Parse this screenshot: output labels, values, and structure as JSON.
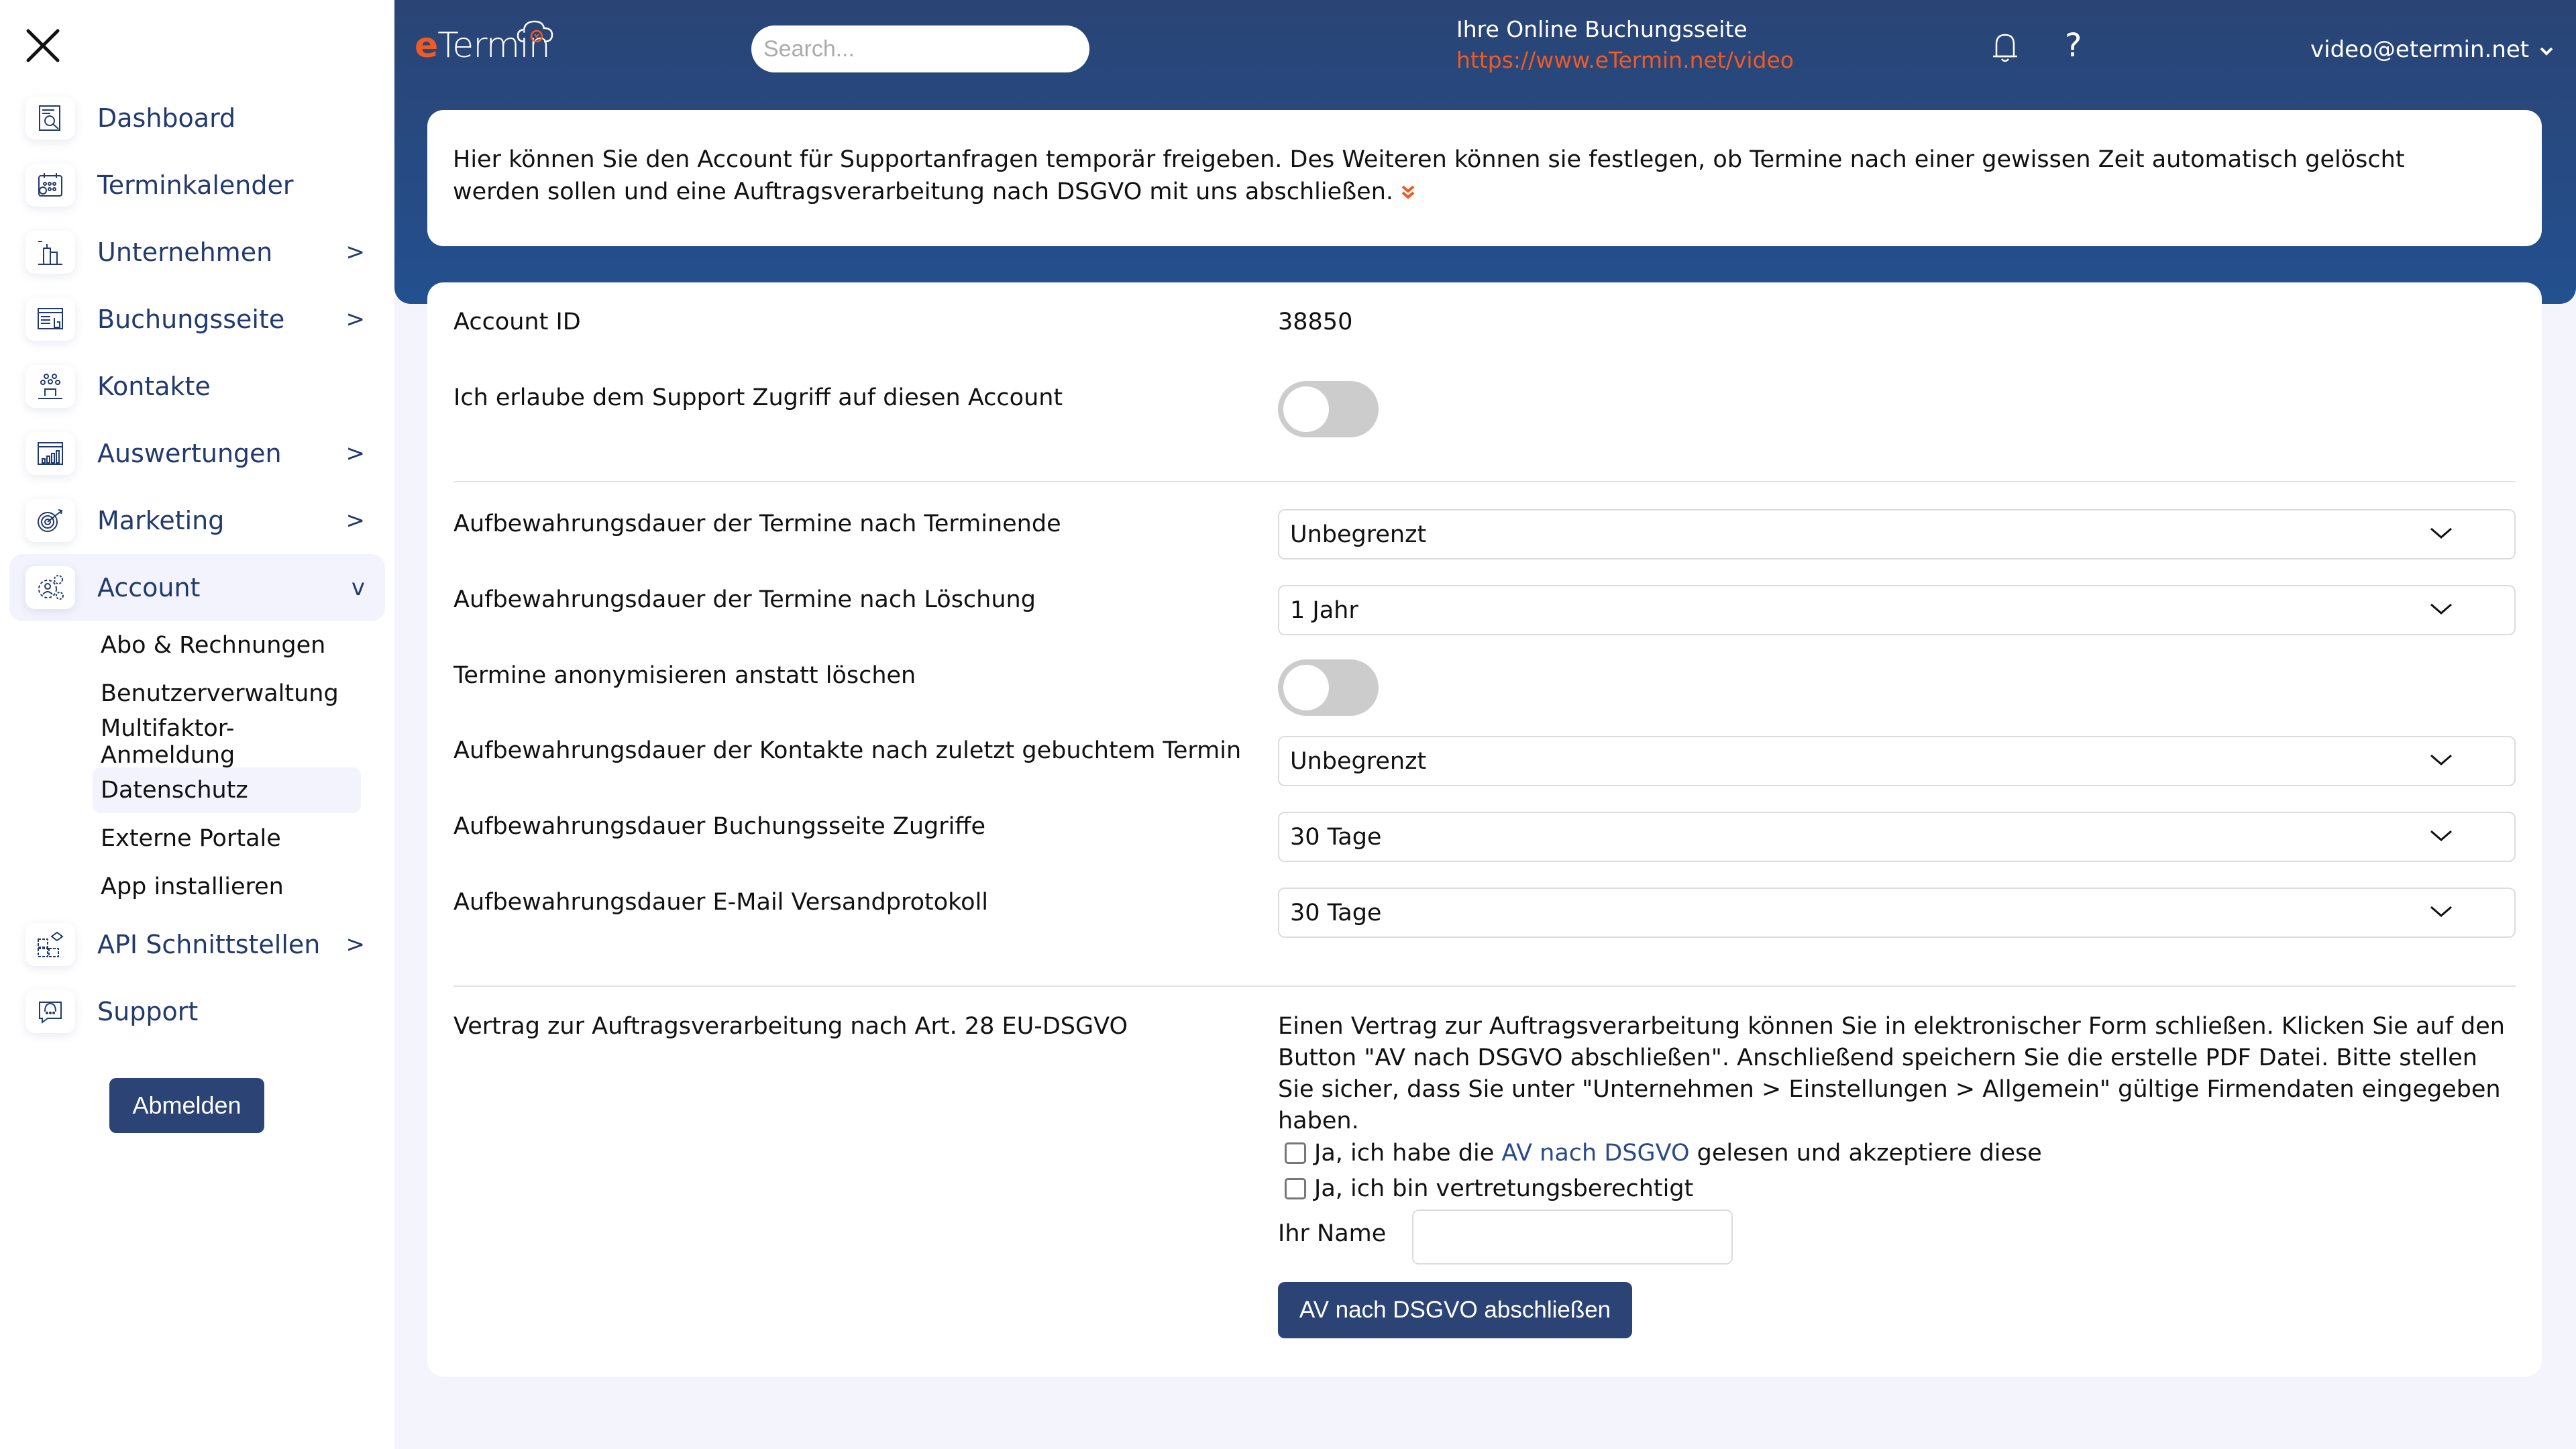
{
  "sidebar": {
    "close_icon": "close-icon",
    "items": [
      {
        "label": "Dashboard",
        "icon": "dashboard-icon",
        "arrow": ""
      },
      {
        "label": "Terminkalender",
        "icon": "calendar-icon",
        "arrow": ""
      },
      {
        "label": "Unternehmen",
        "icon": "company-icon",
        "arrow": ">"
      },
      {
        "label": "Buchungsseite",
        "icon": "booking-page-icon",
        "arrow": ">"
      },
      {
        "label": "Kontakte",
        "icon": "contacts-icon",
        "arrow": ""
      },
      {
        "label": "Auswertungen",
        "icon": "reports-icon",
        "arrow": ">"
      },
      {
        "label": "Marketing",
        "icon": "marketing-icon",
        "arrow": ">"
      },
      {
        "label": "Account",
        "icon": "account-icon",
        "arrow": "v"
      },
      {
        "label": "API Schnittstellen",
        "icon": "api-icon",
        "arrow": ">"
      },
      {
        "label": "Support",
        "icon": "support-icon",
        "arrow": ""
      }
    ],
    "account_subitems": [
      "Abo & Rechnungen",
      "Benutzerverwaltung",
      "Multifaktor-Anmeldung",
      "Datenschutz",
      "Externe Portale",
      "App installieren"
    ],
    "active_subitem": "Datenschutz",
    "logout_label": "Abmelden"
  },
  "header": {
    "logo_e": "e",
    "logo_rest": "Termin",
    "search_placeholder": "Search...",
    "booking_title": "Ihre Online Buchungsseite",
    "booking_url": "https://www.eTermin.net/video",
    "help_label": "?",
    "user_email": "video@etermin.net",
    "user_chevron": "⌄"
  },
  "intro": {
    "text": "Hier können Sie den Account für Supportanfragen temporär freigeben. Des Weiteren können sie festlegen, ob Termine nach einer gewissen Zeit automatisch gelöscht werden sollen und eine Auftragsverarbeitung nach DSGVO mit uns abschließen.",
    "expand_icon": "»"
  },
  "settings": {
    "account_id_label": "Account ID",
    "account_id_value": "38850",
    "support_access_label": "Ich erlaube dem Support Zugriff auf diesen Account",
    "support_access_enabled": false,
    "retention_after_end_label": "Aufbewahrungsdauer der Termine nach Terminende",
    "retention_after_end_value": "Unbegrenzt",
    "retention_after_delete_label": "Aufbewahrungsdauer der Termine nach Löschung",
    "retention_after_delete_value": "1 Jahr",
    "anonymize_label": "Termine anonymisieren anstatt löschen",
    "anonymize_enabled": false,
    "contacts_retention_label": "Aufbewahrungsdauer der Kontakte nach zuletzt gebuchtem Termin",
    "contacts_retention_value": "Unbegrenzt",
    "booking_access_retention_label": "Aufbewahrungsdauer Buchungsseite Zugriffe",
    "booking_access_retention_value": "30 Tage",
    "email_log_retention_label": "Aufbewahrungsdauer E-Mail Versandprotokoll",
    "email_log_retention_value": "30 Tage"
  },
  "av": {
    "label": "Vertrag zur Auftragsverarbeitung nach Art. 28 EU-DSGVO",
    "description": "Einen Vertrag zur Auftragsverarbeitung können Sie in elektronischer Form schließen. Klicken Sie auf den Button \"AV nach DSGVO abschließen\". Anschließend speichern Sie die erstelle PDF Datei. Bitte stellen Sie sicher, dass Sie unter \"Unternehmen > Einstellungen > Allgemein\" gültige Firmendaten eingegeben haben.",
    "checkbox1_pre": "Ja, ich habe die ",
    "checkbox1_link": "AV nach DSGVO",
    "checkbox1_post": " gelesen und akzeptiere diese",
    "checkbox1_checked": false,
    "checkbox2_label": "Ja, ich bin vertretungsberechtigt",
    "checkbox2_checked": false,
    "name_label": "Ihr Name",
    "name_value": "",
    "submit_label": "AV nach DSGVO abschließen"
  },
  "colors": {
    "brand_navy": "#2b4475",
    "brand_orange": "#f15a22",
    "toggle_off": "#cccccc",
    "page_bg": "#f4f5fc"
  }
}
